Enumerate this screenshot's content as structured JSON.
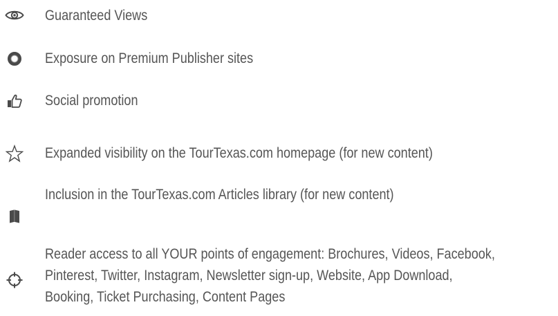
{
  "benefits": {
    "items": [
      {
        "icon": "eye-icon",
        "label": "Guaranteed Views"
      },
      {
        "icon": "circle-ring-icon",
        "label": "Exposure on Premium Publisher sites"
      },
      {
        "icon": "thumbs-up-icon",
        "label": "Social promotion"
      },
      {
        "icon": "star-icon",
        "label": "Expanded visibility on the TourTexas.com homepage (for new content)"
      },
      {
        "icon": "book-icon",
        "label": "Inclusion in the TourTexas.com Articles library (for new content)"
      },
      {
        "icon": "crosshair-icon",
        "lines": [
          "Reader access to all YOUR points of engagement: Brochures, Videos, Facebook,",
          "Pinterest, Twitter, Instagram, Newsletter sign-up, Website, App Download,",
          "Booking, Ticket Purchasing, Content Pages"
        ]
      }
    ]
  },
  "colors": {
    "text": "#555555",
    "icon": "#4a4a4a"
  }
}
